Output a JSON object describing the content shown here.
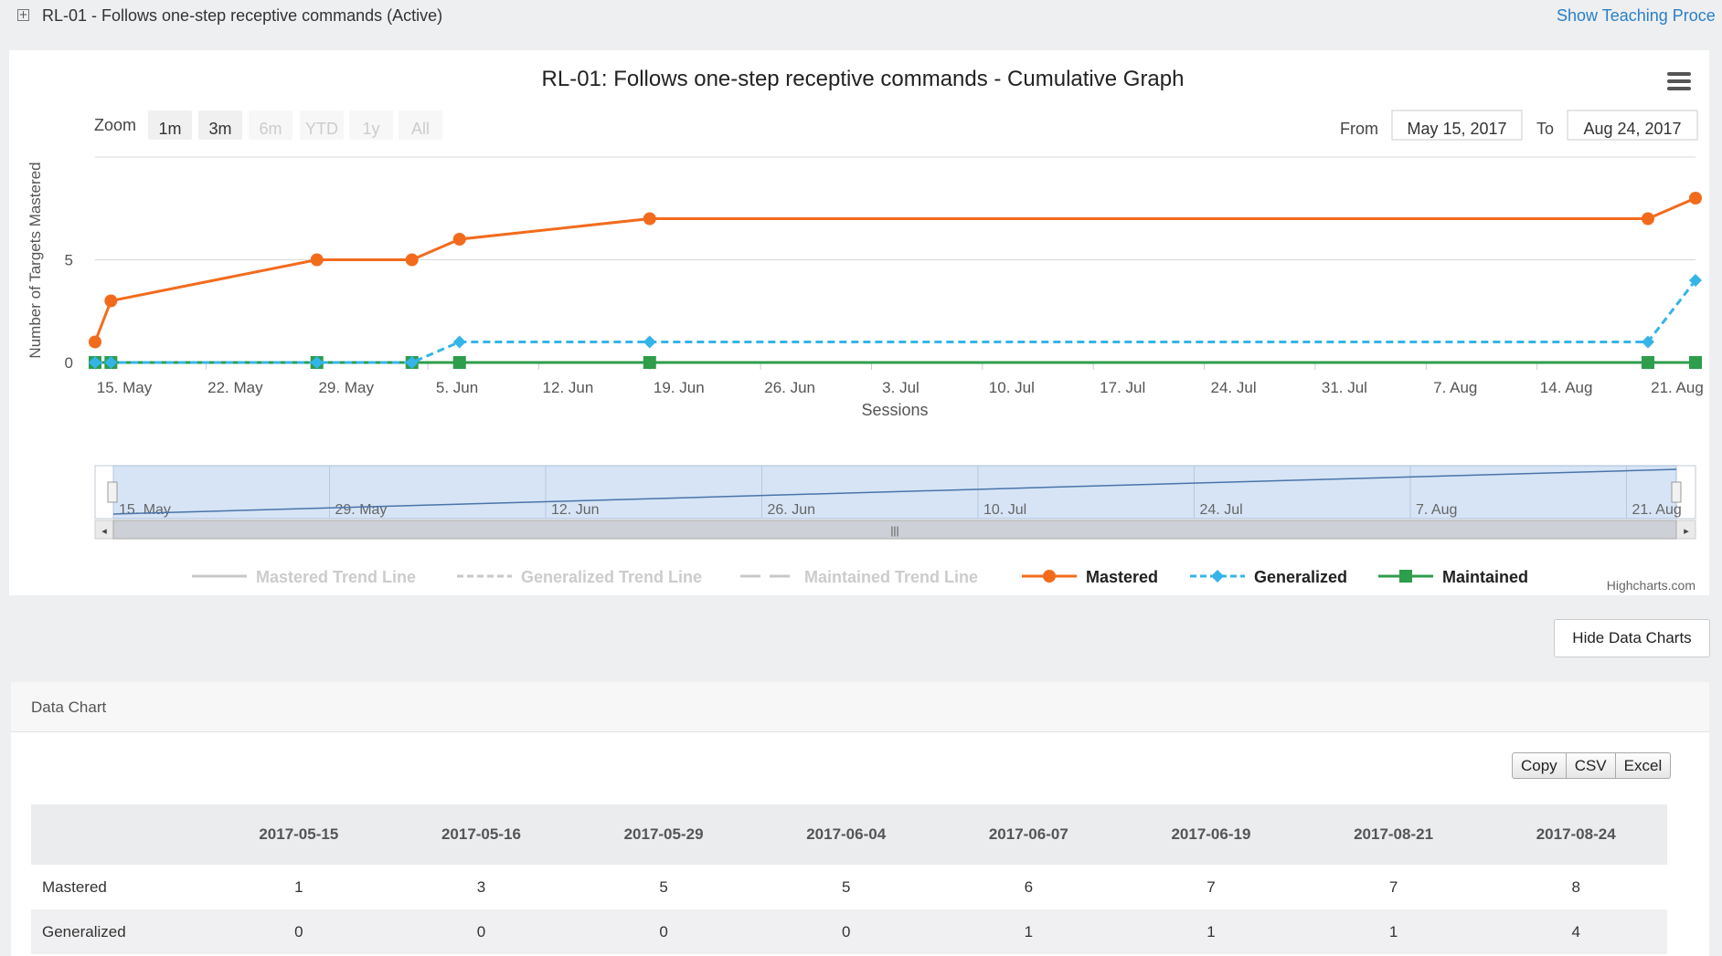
{
  "header": {
    "title": "RL-01 - Follows one-step receptive commands (Active)",
    "teaching_link": "Show Teaching Proce"
  },
  "chart_controls": {
    "zoom_label": "Zoom",
    "zoom_buttons": [
      {
        "label": "1m",
        "enabled": true
      },
      {
        "label": "3m",
        "enabled": true
      },
      {
        "label": "6m",
        "enabled": false
      },
      {
        "label": "YTD",
        "enabled": false
      },
      {
        "label": "1y",
        "enabled": false
      },
      {
        "label": "All",
        "enabled": false
      }
    ],
    "from_label": "From",
    "from_value": "May 15, 2017",
    "to_label": "To",
    "to_value": "Aug 24, 2017"
  },
  "chart_data": {
    "type": "line",
    "title": "RL-01: Follows one-step receptive commands - Cumulative Graph",
    "xlabel": "Sessions",
    "ylabel": "Number of Targets Mastered",
    "x": [
      "2017-05-15",
      "2017-05-16",
      "2017-05-29",
      "2017-06-04",
      "2017-06-07",
      "2017-06-19",
      "2017-08-21",
      "2017-08-24"
    ],
    "xlim": [
      "2017-05-15",
      "2017-08-24"
    ],
    "ylim": [
      0,
      10
    ],
    "yticks": [
      0,
      5
    ],
    "xtick_labels": [
      "15. May",
      "22. May",
      "29. May",
      "5. Jun",
      "12. Jun",
      "19. Jun",
      "26. Jun",
      "3. Jul",
      "10. Jul",
      "17. Jul",
      "24. Jul",
      "31. Jul",
      "7. Aug",
      "14. Aug",
      "21. Aug"
    ],
    "series": [
      {
        "name": "Mastered",
        "values": [
          1,
          3,
          5,
          5,
          6,
          7,
          7,
          8
        ],
        "color": "#f26b1d",
        "marker": "circle",
        "dash": "solid"
      },
      {
        "name": "Generalized",
        "values": [
          0,
          0,
          0,
          0,
          1,
          1,
          1,
          4
        ],
        "color": "#35b4e8",
        "marker": "diamond",
        "dash": "dashed"
      },
      {
        "name": "Maintained",
        "values": [
          0,
          0,
          0,
          0,
          0,
          0,
          0,
          0
        ],
        "color": "#2e9d4c",
        "marker": "square",
        "dash": "solid"
      }
    ],
    "legend": {
      "placement": "bottom",
      "items": [
        {
          "name": "Mastered Trend Line",
          "color": "#c8c8c8",
          "dash": "solid",
          "marker": "none",
          "hidden": true
        },
        {
          "name": "Generalized Trend Line",
          "color": "#c8c8c8",
          "dash": "dashed",
          "marker": "none",
          "hidden": true
        },
        {
          "name": "Maintained Trend Line",
          "color": "#c8c8c8",
          "dash": "longdash",
          "marker": "none",
          "hidden": true
        },
        {
          "name": "Mastered",
          "color": "#f26b1d",
          "dash": "solid",
          "marker": "circle",
          "hidden": false
        },
        {
          "name": "Generalized",
          "color": "#35b4e8",
          "dash": "dashed",
          "marker": "diamond",
          "hidden": false
        },
        {
          "name": "Maintained",
          "color": "#2e9d4c",
          "dash": "solid",
          "marker": "square",
          "hidden": false
        }
      ]
    },
    "navigator": {
      "tick_labels": [
        "15. May",
        "29. May",
        "12. Jun",
        "26. Jun",
        "10. Jul",
        "24. Jul",
        "7. Aug",
        "21. Aug"
      ]
    },
    "credit": "Highcharts.com",
    "grid": true
  },
  "controls": {
    "hide_charts": "Hide Data Charts"
  },
  "data_table": {
    "panel_title": "Data Chart",
    "buttons": [
      "Copy",
      "CSV",
      "Excel"
    ],
    "headers": [
      "",
      "2017-05-15",
      "2017-05-16",
      "2017-05-29",
      "2017-06-04",
      "2017-06-07",
      "2017-06-19",
      "2017-08-21",
      "2017-08-24"
    ],
    "rows": [
      {
        "label": "Mastered",
        "cells": [
          "1",
          "3",
          "5",
          "5",
          "6",
          "7",
          "7",
          "8"
        ]
      },
      {
        "label": "Generalized",
        "cells": [
          "0",
          "0",
          "0",
          "0",
          "1",
          "1",
          "1",
          "4"
        ]
      }
    ]
  }
}
